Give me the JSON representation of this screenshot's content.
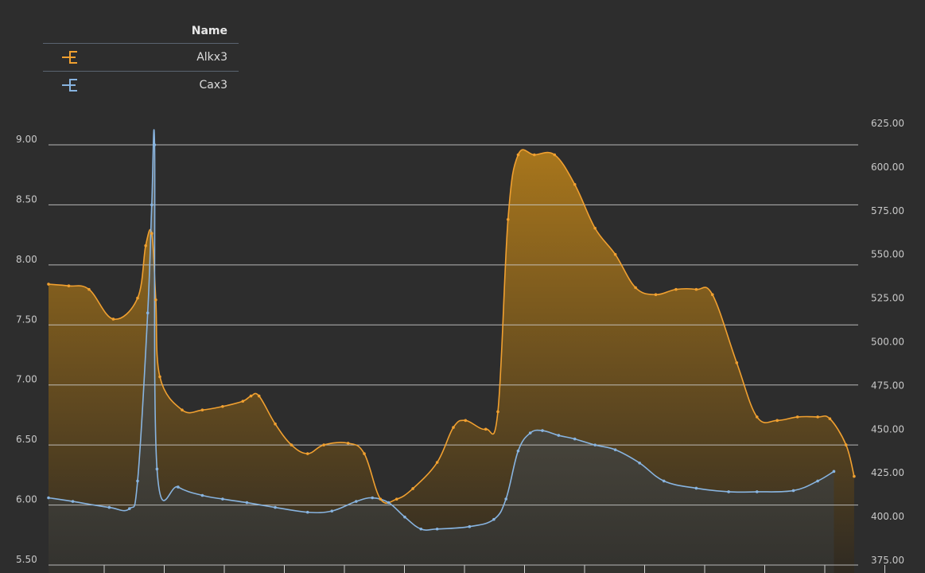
{
  "legend": {
    "header": "Name",
    "items": [
      {
        "label": "Alkx3",
        "color": "#f0a030",
        "icon": "series-line-marker-icon"
      },
      {
        "label": "Cax3",
        "color": "#88b4e0",
        "icon": "series-line-marker-icon"
      }
    ]
  },
  "chart_data": {
    "type": "area",
    "grid": true,
    "legend_position": "top-left",
    "y_left": {
      "ticks": [
        "9.00",
        "8.50",
        "8.00",
        "7.50",
        "7.00",
        "6.50",
        "6.00",
        "5.50"
      ],
      "range": [
        5.5,
        9.0
      ]
    },
    "y_right": {
      "ticks": [
        "625.00",
        "600.00",
        "575.00",
        "550.00",
        "525.00",
        "500.00",
        "475.00",
        "450.00",
        "425.00",
        "400.00",
        "375.00"
      ],
      "range": [
        375,
        625
      ]
    },
    "series": [
      {
        "name": "Alkx3",
        "axis": "right",
        "color": "#f0a030",
        "points": [
          [
            0,
            533
          ],
          [
            0.5,
            532
          ],
          [
            1,
            530
          ],
          [
            1.6,
            513
          ],
          [
            2.2,
            525
          ],
          [
            2.4,
            555
          ],
          [
            2.55,
            562
          ],
          [
            2.65,
            524
          ],
          [
            2.75,
            480
          ],
          [
            3.3,
            461
          ],
          [
            3.8,
            461
          ],
          [
            4.3,
            463
          ],
          [
            4.8,
            466
          ],
          [
            5.0,
            469
          ],
          [
            5.2,
            469
          ],
          [
            5.6,
            453
          ],
          [
            6.0,
            441
          ],
          [
            6.4,
            436
          ],
          [
            6.8,
            441
          ],
          [
            7.4,
            442
          ],
          [
            7.8,
            436
          ],
          [
            8.2,
            410
          ],
          [
            8.6,
            410
          ],
          [
            9.0,
            416
          ],
          [
            9.6,
            431
          ],
          [
            10.0,
            451
          ],
          [
            10.3,
            455
          ],
          [
            10.8,
            450
          ],
          [
            11.1,
            460
          ],
          [
            11.35,
            570
          ],
          [
            11.6,
            607
          ],
          [
            12.0,
            607
          ],
          [
            12.5,
            607
          ],
          [
            13.0,
            590
          ],
          [
            13.5,
            565
          ],
          [
            14.0,
            550
          ],
          [
            14.5,
            531
          ],
          [
            15.0,
            527
          ],
          [
            15.5,
            530
          ],
          [
            16.0,
            530
          ],
          [
            16.4,
            527
          ],
          [
            17.0,
            488
          ],
          [
            17.5,
            457
          ],
          [
            18.0,
            455
          ],
          [
            18.5,
            457
          ],
          [
            19.0,
            457
          ],
          [
            19.3,
            456
          ],
          [
            19.7,
            441
          ],
          [
            19.9,
            423
          ]
        ]
      },
      {
        "name": "Cax3",
        "axis": "left",
        "color": "#88b4e0",
        "points": [
          [
            0,
            6.06
          ],
          [
            0.6,
            6.03
          ],
          [
            1.5,
            5.98
          ],
          [
            2.0,
            5.97
          ],
          [
            2.2,
            6.2
          ],
          [
            2.45,
            7.6
          ],
          [
            2.55,
            8.5
          ],
          [
            2.62,
            9.0
          ],
          [
            2.68,
            6.3
          ],
          [
            3.2,
            6.15
          ],
          [
            3.8,
            6.08
          ],
          [
            4.3,
            6.05
          ],
          [
            4.9,
            6.02
          ],
          [
            5.6,
            5.98
          ],
          [
            6.4,
            5.94
          ],
          [
            7.0,
            5.95
          ],
          [
            7.6,
            6.03
          ],
          [
            8.0,
            6.06
          ],
          [
            8.4,
            6.02
          ],
          [
            8.8,
            5.9
          ],
          [
            9.2,
            5.8
          ],
          [
            9.6,
            5.8
          ],
          [
            10.4,
            5.82
          ],
          [
            11.0,
            5.88
          ],
          [
            11.3,
            6.05
          ],
          [
            11.6,
            6.45
          ],
          [
            11.9,
            6.6
          ],
          [
            12.2,
            6.62
          ],
          [
            12.6,
            6.58
          ],
          [
            13.0,
            6.55
          ],
          [
            13.5,
            6.5
          ],
          [
            14.0,
            6.46
          ],
          [
            14.6,
            6.35
          ],
          [
            15.2,
            6.2
          ],
          [
            16.0,
            6.14
          ],
          [
            16.8,
            6.11
          ],
          [
            17.5,
            6.11
          ],
          [
            18.4,
            6.12
          ],
          [
            19.0,
            6.2
          ],
          [
            19.4,
            6.28
          ]
        ]
      }
    ]
  }
}
